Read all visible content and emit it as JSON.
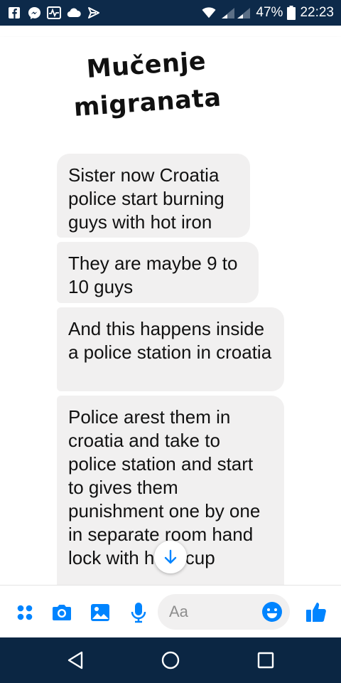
{
  "status_bar": {
    "battery": "47%",
    "time": "22:23",
    "icons": [
      "facebook-icon",
      "messenger-icon",
      "activity-icon",
      "cloud-icon",
      "send-icon",
      "wifi-icon",
      "signal-icon",
      "battery-icon"
    ]
  },
  "overlay": {
    "title_line1": "Mučenje",
    "title_line2": "migranata"
  },
  "messages": [
    {
      "text": "Sister now Croatia police start burning guys with hot iron"
    },
    {
      "text": "They are maybe 9 to 10 guys"
    },
    {
      "text": "And this happens inside a police station in croatia"
    },
    {
      "text": "Police arest them in croatia and take to police station and start to gives them punishment one by one in separate room hand lock with handcup"
    }
  ],
  "composer": {
    "placeholder": "Aa",
    "icons": [
      "apps-icon",
      "camera-icon",
      "gallery-icon",
      "microphone-icon",
      "emoji-icon",
      "thumbs-up-icon"
    ]
  },
  "colors": {
    "status_bar": "#0d2a4a",
    "nav_bar": "#0b2643",
    "bubble": "#f1f0f0",
    "accent": "#0084ff"
  }
}
